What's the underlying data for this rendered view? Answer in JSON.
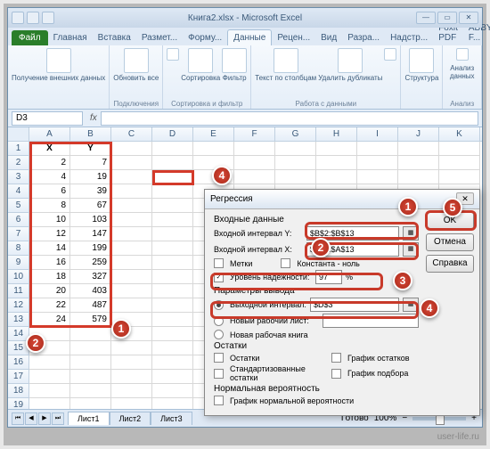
{
  "title": "Книга2.xlsx - Microsoft Excel",
  "tabs": {
    "file": "Файл",
    "home": "Главная",
    "insert": "Вставка",
    "layout": "Размет...",
    "formulas": "Форму...",
    "data": "Данные",
    "review": "Рецен...",
    "view": "Вид",
    "dev": "Разра...",
    "addins": "Надстр...",
    "foxit": "Foxit PDF",
    "abbyy": "ABBYY F...",
    "help": "♡"
  },
  "ribbon": {
    "g1": {
      "btn": "Получение внешних данных",
      "label": ""
    },
    "g2": {
      "btn": "Обновить все",
      "label": "Подключения"
    },
    "g3": {
      "sort": "Сортировка",
      "filter": "Фильтр",
      "label": "Сортировка и фильтр"
    },
    "g4": {
      "text": "Текст по столбцам",
      "dup": "Удалить дубликаты",
      "label": "Работа с данными"
    },
    "g5": {
      "struct": "Структура",
      "label": ""
    },
    "g6": {
      "analysis": "Анализ данных",
      "label": "Анализ"
    }
  },
  "namebox": "D3",
  "columns": [
    "A",
    "B",
    "C",
    "D",
    "E",
    "F",
    "G",
    "H",
    "I",
    "J",
    "K"
  ],
  "rows": [
    1,
    2,
    3,
    4,
    5,
    6,
    7,
    8,
    9,
    10,
    11,
    12,
    13,
    14,
    15,
    16,
    17,
    18,
    19
  ],
  "data": {
    "header": {
      "x": "X",
      "y": "Y"
    },
    "x": [
      2,
      4,
      6,
      8,
      10,
      12,
      14,
      16,
      18,
      20,
      22,
      24
    ],
    "y": [
      7,
      19,
      39,
      67,
      103,
      147,
      199,
      259,
      327,
      403,
      487,
      579
    ]
  },
  "dialog": {
    "title": "Регрессия",
    "input_section": "Входные данные",
    "y_label": "Входной интервал Y:",
    "y_val": "$B$2:$B$13",
    "x_label": "Входной интервал X:",
    "x_val": "$A$2:$A$13",
    "labels": "Метки",
    "const": "Константа - ноль",
    "conf": "Уровень надежности:",
    "conf_val": "97",
    "pct": "%",
    "out_section": "Параметры вывода",
    "out_range": "Выходной интервал:",
    "out_val": "$D$3",
    "new_sheet": "Новый рабочий лист:",
    "new_book": "Новая рабочая книга",
    "resid_section": "Остатки",
    "resid": "Остатки",
    "resid_std": "Стандартизованные остатки",
    "resid_plot": "График остатков",
    "fit_plot": "График подбора",
    "prob_section": "Нормальная вероятность",
    "prob": "График нормальной вероятности",
    "ok": "OK",
    "cancel": "Отмена",
    "help": "Справка"
  },
  "sheets": {
    "s1": "Лист1",
    "s2": "Лист2",
    "s3": "Лист3"
  },
  "status": "Готово",
  "zoom": "100%",
  "watermark": "user-life.ru"
}
